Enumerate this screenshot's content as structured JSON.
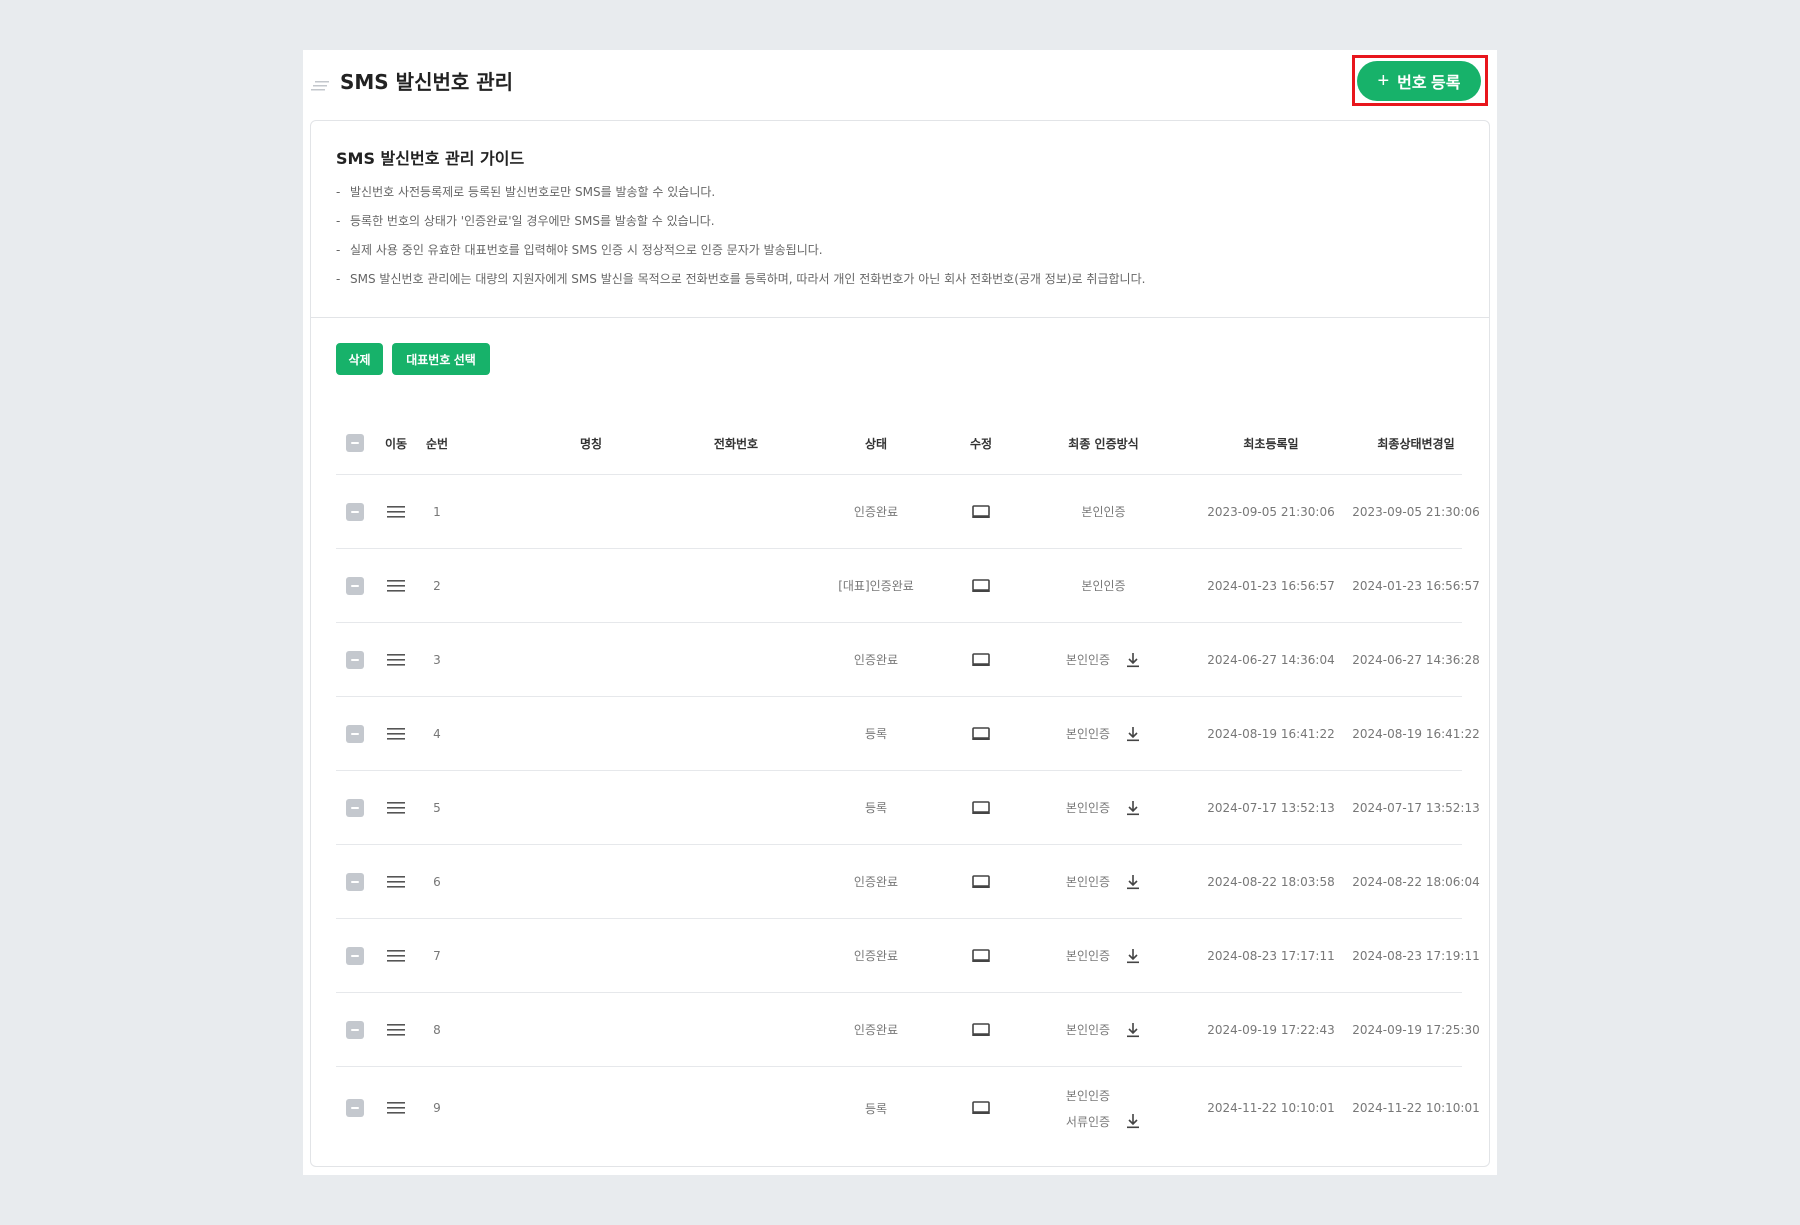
{
  "header": {
    "title": "SMS 발신번호 관리",
    "add_button": "번호 등록"
  },
  "guide": {
    "title": "SMS 발신번호 관리 가이드",
    "dash": "-",
    "items": [
      "발신번호 사전등록제로 등록된 발신번호로만 SMS를 발송할 수 있습니다.",
      "등록한 번호의 상태가 '인증완료'일 경우에만 SMS를 발송할 수 있습니다.",
      "실제 사용 중인 유효한 대표번호를 입력해야 SMS 인증 시 정상적으로 인증 문자가 발송됩니다.",
      "SMS 발신번호 관리에는 대량의 지원자에게 SMS 발신을 목적으로 전화번호를 등록하며, 따라서 개인 전화번호가 아닌 회사 전화번호(공개 정보)로 취급합니다."
    ]
  },
  "actions": {
    "delete": "삭제",
    "select_main": "대표번호 선택"
  },
  "table": {
    "headers": {
      "move": "이동",
      "seq": "순번",
      "name": "명칭",
      "phone": "전화번호",
      "status": "상태",
      "edit": "수정",
      "auth": "최종 인증방식",
      "registered": "최초등록일",
      "changed": "최종상태변경일"
    },
    "rows": [
      {
        "seq": "1",
        "name": "",
        "phone": "",
        "status": "인증완료",
        "auth": [
          "본인인증"
        ],
        "download": false,
        "registered": "2023-09-05 21:30:06",
        "changed": "2023-09-05 21:30:06"
      },
      {
        "seq": "2",
        "name": "",
        "phone": "",
        "status": "[대표]인증완료",
        "auth": [
          "본인인증"
        ],
        "download": false,
        "registered": "2024-01-23 16:56:57",
        "changed": "2024-01-23 16:56:57"
      },
      {
        "seq": "3",
        "name": "",
        "phone": "",
        "status": "인증완료",
        "auth": [
          "본인인증"
        ],
        "download": true,
        "registered": "2024-06-27 14:36:04",
        "changed": "2024-06-27 14:36:28"
      },
      {
        "seq": "4",
        "name": "",
        "phone": "",
        "status": "등록",
        "auth": [
          "본인인증"
        ],
        "download": true,
        "registered": "2024-08-19 16:41:22",
        "changed": "2024-08-19 16:41:22"
      },
      {
        "seq": "5",
        "name": "",
        "phone": "",
        "status": "등록",
        "auth": [
          "본인인증"
        ],
        "download": true,
        "registered": "2024-07-17 13:52:13",
        "changed": "2024-07-17 13:52:13"
      },
      {
        "seq": "6",
        "name": "",
        "phone": "",
        "status": "인증완료",
        "auth": [
          "본인인증"
        ],
        "download": true,
        "registered": "2024-08-22 18:03:58",
        "changed": "2024-08-22 18:06:04"
      },
      {
        "seq": "7",
        "name": "",
        "phone": "",
        "status": "인증완료",
        "auth": [
          "본인인증"
        ],
        "download": true,
        "registered": "2024-08-23 17:17:11",
        "changed": "2024-08-23 17:19:11"
      },
      {
        "seq": "8",
        "name": "",
        "phone": "",
        "status": "인증완료",
        "auth": [
          "본인인증"
        ],
        "download": true,
        "registered": "2024-09-19 17:22:43",
        "changed": "2024-09-19 17:25:30"
      },
      {
        "seq": "9",
        "name": "",
        "phone": "",
        "status": "등록",
        "auth": [
          "본인인증",
          "서류인증"
        ],
        "download": true,
        "registered": "2024-11-22 10:10:01",
        "changed": "2024-11-22 10:10:01"
      }
    ]
  },
  "colors": {
    "accent": "#17b26a",
    "highlight": "#e8161c"
  },
  "icons": {
    "menu": "menu-lines-icon",
    "add": "plus-icon",
    "drag": "drag-handle-icon",
    "edit": "monitor-edit-icon",
    "download": "download-icon"
  }
}
